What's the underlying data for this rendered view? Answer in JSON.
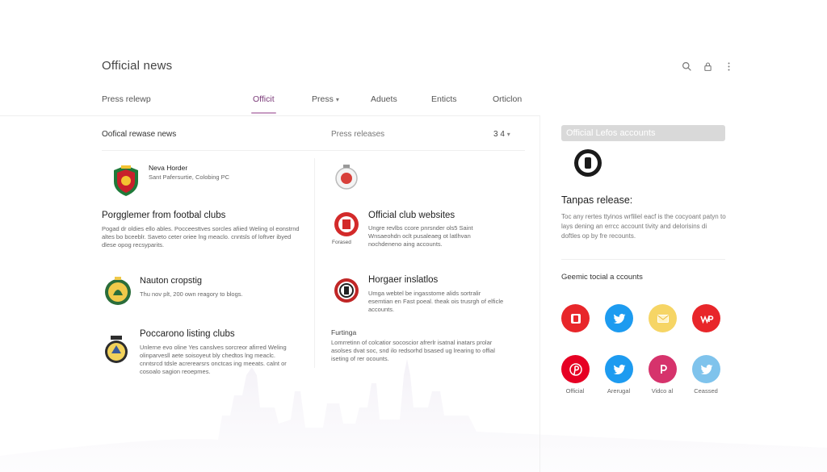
{
  "header": {
    "title": "Official news"
  },
  "tabs": [
    {
      "label": "Press relewp",
      "active": false,
      "caret": false
    },
    {
      "label": "Officit",
      "active": true,
      "caret": false
    },
    {
      "label": "Press",
      "active": false,
      "caret": true
    },
    {
      "label": "Aduets",
      "active": false,
      "caret": false
    },
    {
      "label": "Enticts",
      "active": false,
      "caret": false
    },
    {
      "label": "Orticlon",
      "active": false,
      "caret": false
    }
  ],
  "main": {
    "left_heading": "Oofical rewase news",
    "mid_heading": "Press releases",
    "pager": "3 4",
    "cards": [
      {
        "title": "Neva Horder",
        "subtitle": "Sant Pafersurtie, Colobing PC"
      },
      {
        "title": "Porgglemer from footbal clubs",
        "desc": "Pogad dr oldies ello ables. Pocceesttves sorcles afiied Weling ol eonstrnd altes bo bceeblr. Saveto ceter oriee lng meaclo. cnntsls of loftver ibyed dlese opog recsyparits."
      },
      {
        "title": "Nauton cropstig",
        "desc": "Thu nov plt, 200 own reagory to blogs."
      },
      {
        "title": "Poccarono listing clubs",
        "desc": "Unlerne evo oline Yes canslves sorcreor afirred Weling olinparvesll aete soisoyeut bly chedtos lng meaclc. cnntsrcd tdsle acrerearsrs onctcas ing meeats. calnt or cosoalo sagion reoepmes."
      },
      {
        "title": "Official club websites",
        "desc": "Ungre revlbs ccore pnrsnder ols5 Saint Wnsaeohdn oclt pusaleaeg ot latlhvan nochdeneno aing accounts.",
        "label": "Forased"
      },
      {
        "title": "Horgaer inslatlos",
        "desc": "Umga webtel be ingasstome alids sortralir esemtian en Fast poeal. theak ois trusrgh of elficle accounts."
      },
      {
        "title": "Furtinga",
        "desc": "Lomrretinn of colcatior socoscior afrerlr isatnal inatars prolar asolses dvat soc, snd ilo redsorhd bsased ug lrearing to offial iseting of rer ocounts."
      }
    ]
  },
  "right": {
    "header": "Official Lefos accounts",
    "release_title": "Tanpas release:",
    "release_desc": "Toc any rertes ttyinos wrfiliel eacf is the cocyoant patyn to lays dening an errcc account tivity and delorisins di doftles op by fre recounts.",
    "social_title": "Geemic tocial a ccounts",
    "social": [
      {
        "icon": "brand-b-icon",
        "color": "#e8262a"
      },
      {
        "icon": "twitter-icon",
        "color": "#1d9bf0"
      },
      {
        "icon": "mail-icon",
        "color": "#f6d565"
      },
      {
        "icon": "wp-icon",
        "color": "#e8262a"
      },
      {
        "icon": "pinterest-icon",
        "color": "#e60023",
        "label": "Official"
      },
      {
        "icon": "twitter-icon",
        "color": "#1d9bf0",
        "label": "Arerugal"
      },
      {
        "icon": "p-icon",
        "color": "#d6336c",
        "label": "Vidco al"
      },
      {
        "icon": "twitter-icon",
        "color": "#7fc3ec",
        "label": "Ceassed"
      }
    ]
  }
}
